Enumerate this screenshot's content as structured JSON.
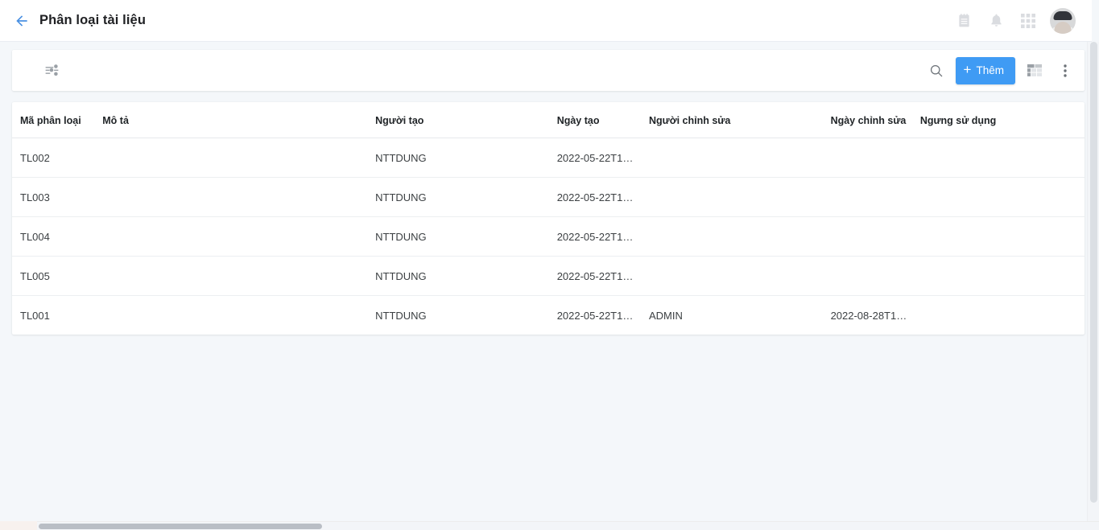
{
  "header": {
    "back_icon": "arrow-left-icon",
    "title": "Phân loại tài liệu",
    "icons": [
      {
        "name": "notepad-icon"
      },
      {
        "name": "bell-icon"
      },
      {
        "name": "apps-grid-icon"
      }
    ],
    "avatar_name": "user-avatar"
  },
  "toolbar": {
    "filter_icon": "filter-settings-icon",
    "search_icon": "search-icon",
    "add_label": "Thêm",
    "add_plus": "+",
    "table_view_icon": "table-view-icon",
    "more_icon": "more-vertical-icon"
  },
  "table": {
    "columns": [
      "Mã phân loại",
      "Mô tả",
      "Người tạo",
      "Ngày tạo",
      "Người chỉnh sửa",
      "Ngày chỉnh sửa",
      "Ngưng sử dụng"
    ],
    "rows": [
      {
        "ma_phan_loai": "TL002",
        "mo_ta": "",
        "nguoi_tao": "NTTDUNG",
        "ngay_tao": "2022-05-22T1…",
        "nguoi_chinh_sua": "",
        "ngay_chinh_sua": "",
        "ngung_su_dung": ""
      },
      {
        "ma_phan_loai": "TL003",
        "mo_ta": "",
        "nguoi_tao": "NTTDUNG",
        "ngay_tao": "2022-05-22T1…",
        "nguoi_chinh_sua": "",
        "ngay_chinh_sua": "",
        "ngung_su_dung": ""
      },
      {
        "ma_phan_loai": "TL004",
        "mo_ta": "",
        "nguoi_tao": "NTTDUNG",
        "ngay_tao": "2022-05-22T1…",
        "nguoi_chinh_sua": "",
        "ngay_chinh_sua": "",
        "ngung_su_dung": ""
      },
      {
        "ma_phan_loai": "TL005",
        "mo_ta": "",
        "nguoi_tao": "NTTDUNG",
        "ngay_tao": "2022-05-22T1…",
        "nguoi_chinh_sua": "",
        "ngay_chinh_sua": "",
        "ngung_su_dung": ""
      },
      {
        "ma_phan_loai": "TL001",
        "mo_ta": "",
        "nguoi_tao": "NTTDUNG",
        "ngay_tao": "2022-05-22T1…",
        "nguoi_chinh_sua": "ADMIN",
        "ngay_chinh_sua": "2022-08-28T1…",
        "ngung_su_dung": ""
      }
    ]
  },
  "colors": {
    "accent": "#3f9bf4",
    "back_arrow": "#4a90e2",
    "page_background": "#f4f7fa",
    "card": "#ffffff",
    "text": "#3c4043"
  }
}
